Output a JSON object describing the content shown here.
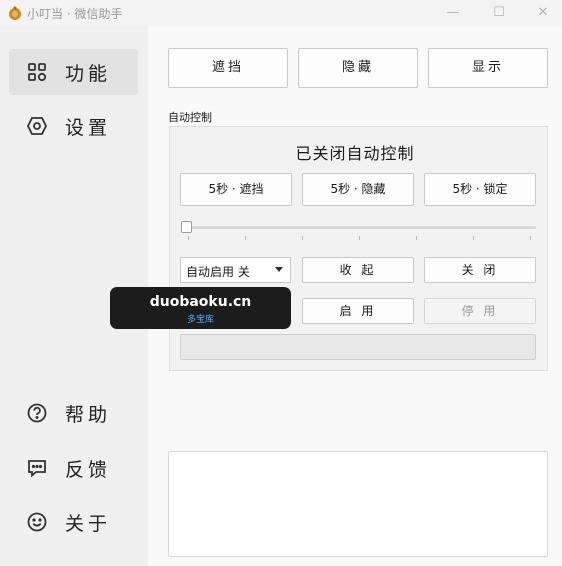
{
  "window": {
    "title": "小叮当 · 微信助手",
    "controls": {
      "minimize": "—",
      "maximize": "☐",
      "close": "✕"
    }
  },
  "sidebar": {
    "items": [
      {
        "label": "功能",
        "icon": "grid-icon",
        "active": true
      },
      {
        "label": "设置",
        "icon": "gear-icon",
        "active": false
      },
      {
        "label": "帮助",
        "icon": "help-icon",
        "active": false
      },
      {
        "label": "反馈",
        "icon": "feedback-icon",
        "active": false
      },
      {
        "label": "关于",
        "icon": "smiley-icon",
        "active": false
      }
    ]
  },
  "toolbar": {
    "block_label": "遮挡",
    "hide_label": "隐藏",
    "show_label": "显示"
  },
  "auto_control": {
    "group_label": "自动控制",
    "status": "已关闭自动控制",
    "timer_buttons": [
      "5秒 · 遮挡",
      "5秒 · 隐藏",
      "5秒 · 锁定"
    ],
    "slider_value": 0,
    "auto_start": {
      "selected": "自动启用 关",
      "options": [
        "自动启用 关"
      ]
    },
    "collapse_label": "收 起",
    "close_label": "关 闭",
    "enable_label": "启 用",
    "disable_label": "停 用",
    "progress": 0
  },
  "log": {
    "text": ""
  },
  "watermark": {
    "main": "duobaoku.cn",
    "sub": "多宝库"
  },
  "colors": {
    "accent_active": "#e2e2e2",
    "progress": "#06b025",
    "watermark_bg": "#1c1c1c",
    "watermark_sub": "#5aa8f0"
  }
}
